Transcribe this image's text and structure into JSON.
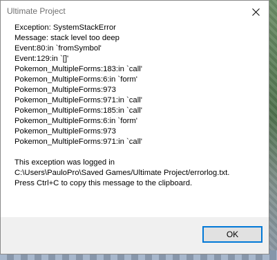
{
  "window": {
    "title": "Ultimate Project",
    "close_icon": "close-icon"
  },
  "message": {
    "lines": [
      "Exception: SystemStackError",
      "Message: stack level too deep",
      "Event:80:in `fromSymbol'",
      "Event:129:in `[]'",
      "Pokemon_MultipleForms:183:in `call'",
      "Pokemon_MultipleForms:6:in `form'",
      "Pokemon_MultipleForms:973",
      "Pokemon_MultipleForms:971:in `call'",
      "Pokemon_MultipleForms:185:in `call'",
      "Pokemon_MultipleForms:6:in `form'",
      "Pokemon_MultipleForms:973",
      "Pokemon_MultipleForms:971:in `call'",
      "",
      "This exception was logged in",
      "C:\\Users\\PauloPro\\Saved Games/Ultimate Project/errorlog.txt.",
      "Press Ctrl+C to copy this message to the clipboard."
    ]
  },
  "footer": {
    "ok_label": "OK"
  },
  "colors": {
    "accent": "#0078d7",
    "footer_bg": "#f0f0f0",
    "button_bg": "#e1e1e1"
  }
}
